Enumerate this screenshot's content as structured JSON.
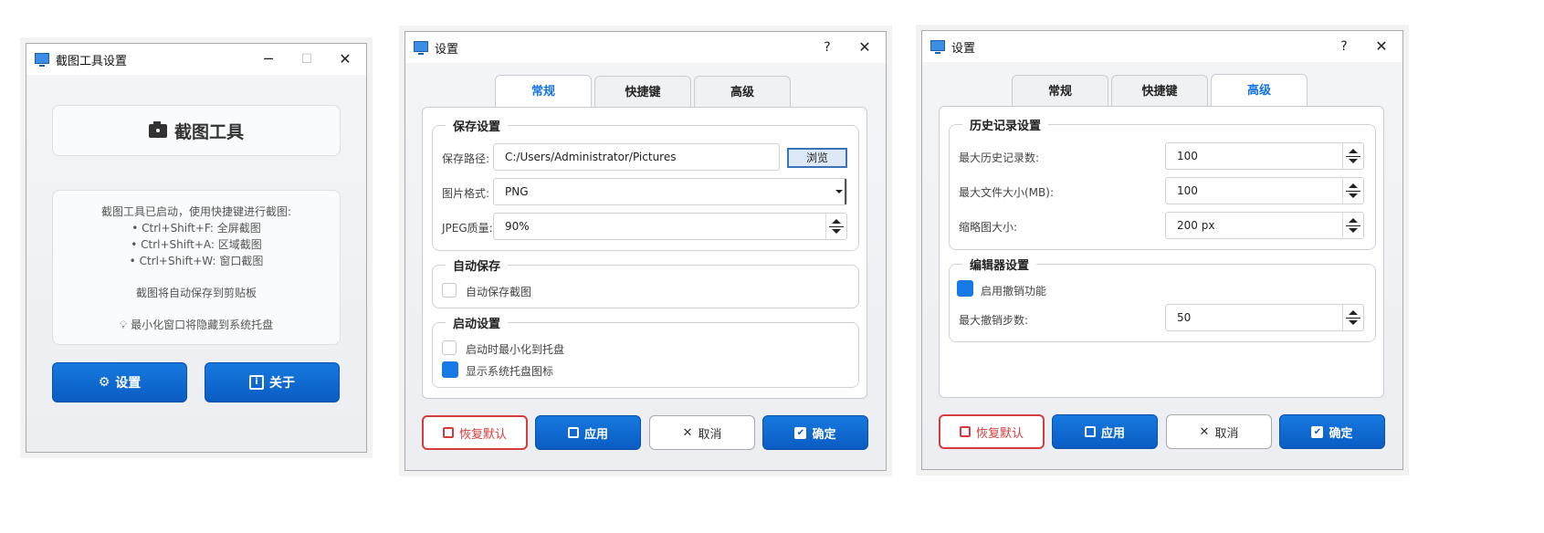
{
  "colors": {
    "accent": "#1473e6",
    "danger": "#d63b3b"
  },
  "main_window": {
    "title": "截图工具设置",
    "header_icon": "camera-icon",
    "header": "截图工具",
    "info_lines": [
      "截图工具已启动，使用快捷键进行截图:",
      "• Ctrl+Shift+F: 全屏截图",
      "• Ctrl+Shift+A: 区域截图",
      "• Ctrl+Shift+W: 窗口截图"
    ],
    "clipboard_note": "截图将自动保存到剪贴板",
    "tray_note": "最小化窗口将隐藏到系统托盘",
    "settings_button": "设置",
    "about_button": "关于"
  },
  "dialog_general": {
    "title": "设置",
    "help": "?",
    "tabs": [
      "常规",
      "快捷键",
      "高级"
    ],
    "save_group": "保存设置",
    "save_path_label": "保存路径:",
    "save_path_value": "C:/Users/Administrator/Pictures",
    "browse_button": "浏览",
    "format_label": "图片格式:",
    "format_value": "PNG",
    "jpeg_label": "JPEG质量:",
    "jpeg_value": "90%",
    "autosave_group": "自动保存",
    "autosave_check": "自动保存截图",
    "autosave_checked": false,
    "startup_group": "启动设置",
    "startup_min_check": "启动时最小化到托盘",
    "startup_min_checked": false,
    "tray_icon_check": "显示系统托盘图标",
    "tray_icon_checked": true,
    "buttons": {
      "reset": "恢复默认",
      "apply": "应用",
      "cancel": "取消",
      "ok": "确定"
    }
  },
  "dialog_advanced": {
    "title": "设置",
    "help": "?",
    "tabs": [
      "常规",
      "快捷键",
      "高级"
    ],
    "history_group": "历史记录设置",
    "max_history_label": "最大历史记录数:",
    "max_history_value": "100",
    "max_size_label": "最大文件大小(MB):",
    "max_size_value": "100",
    "thumb_label": "缩略图大小:",
    "thumb_value": "200 px",
    "editor_group": "编辑器设置",
    "undo_check": "启用撤销功能",
    "undo_checked": true,
    "undo_steps_label": "最大撤销步数:",
    "undo_steps_value": "50",
    "buttons": {
      "reset": "恢复默认",
      "apply": "应用",
      "cancel": "取消",
      "ok": "确定"
    }
  }
}
